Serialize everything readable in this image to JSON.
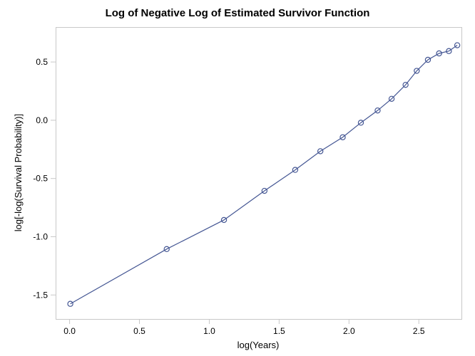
{
  "chart_data": {
    "type": "line",
    "title": "Log of Negative Log of Estimated Survivor Function",
    "xlabel": "log(Years)",
    "ylabel": "log[-log(Survival Probability)]",
    "xlim": [
      -0.1,
      2.8
    ],
    "ylim": [
      -1.7,
      0.8
    ],
    "xticks": [
      0.0,
      0.5,
      1.0,
      1.5,
      2.0,
      2.5
    ],
    "yticks": [
      -1.5,
      -1.0,
      -0.5,
      0.0,
      0.5
    ],
    "x": [
      0.0,
      0.69,
      1.1,
      1.39,
      1.61,
      1.79,
      1.95,
      2.08,
      2.2,
      2.3,
      2.4,
      2.48,
      2.56,
      2.64,
      2.71,
      2.77
    ],
    "y": [
      -1.57,
      -1.1,
      -0.85,
      -0.6,
      -0.42,
      -0.26,
      -0.14,
      -0.015,
      0.09,
      0.19,
      0.31,
      0.43,
      0.525,
      0.58,
      0.6,
      0.65
    ],
    "marker_color": "#445693",
    "line_color": "#445693"
  }
}
